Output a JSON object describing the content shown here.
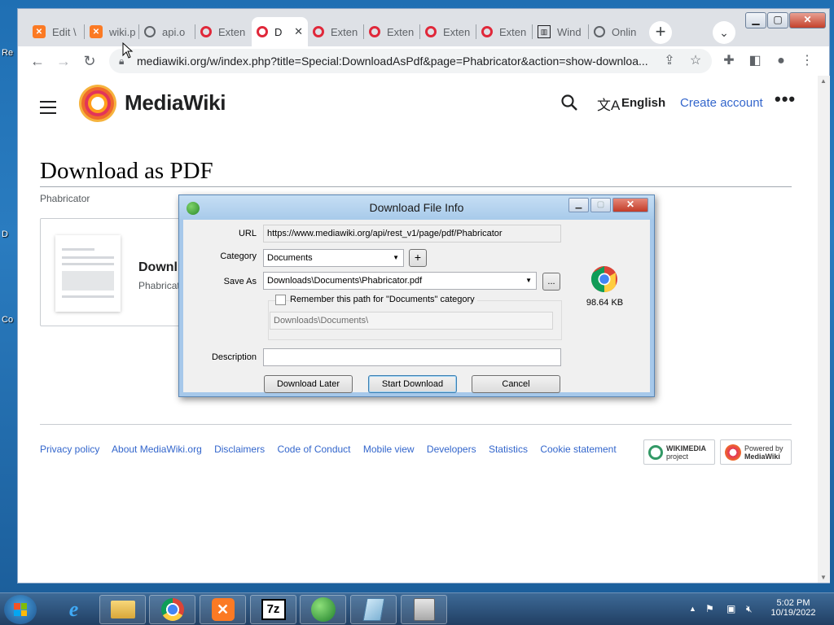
{
  "desktop": {
    "labels": [
      "Re",
      "D",
      "Co"
    ]
  },
  "browser": {
    "tabs": [
      {
        "label": "Edit \\",
        "icon": "xampp-icon"
      },
      {
        "label": "wiki.p",
        "icon": "xampp-icon"
      },
      {
        "label": "api.o",
        "icon": "globe-icon"
      },
      {
        "label": "Exten",
        "icon": "opera-icon"
      },
      {
        "label": "D",
        "icon": "opera-icon",
        "active": true
      },
      {
        "label": "Exten",
        "icon": "opera-icon"
      },
      {
        "label": "Exten",
        "icon": "opera-icon"
      },
      {
        "label": "Exten",
        "icon": "opera-icon"
      },
      {
        "label": "Exten",
        "icon": "opera-icon"
      },
      {
        "label": "Wind",
        "icon": "bank-icon"
      },
      {
        "label": "Onlin",
        "icon": "globe-icon"
      }
    ],
    "active_tab_close": "✕",
    "new_tab": "+",
    "url": "mediawiki.org/w/index.php?title=Special:DownloadAsPdf&page=Phabricator&action=show-downloa..."
  },
  "page": {
    "site_name": "MediaWiki",
    "language": "English",
    "create_account": "Create account",
    "title": "Download as PDF",
    "subtitle": "Phabricator",
    "card_title": "Downl",
    "card_sub": "Phabricat",
    "footer_links": [
      "Privacy policy",
      "About MediaWiki.org",
      "Disclaimers",
      "Code of Conduct",
      "Mobile view",
      "Developers",
      "Statistics",
      "Cookie statement"
    ],
    "badge_wikimedia": [
      "WIKIMEDIA",
      "project"
    ],
    "badge_powered": [
      "Powered by",
      "MediaWiki"
    ]
  },
  "dialog": {
    "title": "Download File Info",
    "url_label": "URL",
    "url_value": "https://www.mediawiki.org/api/rest_v1/page/pdf/Phabricator",
    "category_label": "Category",
    "category_value": "Documents",
    "add_category": "+",
    "save_as_label": "Save As",
    "save_as_value": "Downloads\\Documents\\Phabricator.pdf",
    "browse": "...",
    "remember_label": "Remember this path for \"Documents\" category",
    "remember_checked": false,
    "path_value": "Downloads\\Documents\\",
    "description_label": "Description",
    "description_value": "",
    "file_size": "98.64 KB",
    "btn_later": "Download Later",
    "btn_start": "Start Download",
    "btn_cancel": "Cancel"
  },
  "taskbar": {
    "apps": [
      "ie-icon",
      "explorer-icon",
      "chrome-icon",
      "xampp-icon",
      "7zip-icon",
      "idm-icon",
      "notepad-icon",
      "archive-icon"
    ],
    "time": "5:02 PM",
    "date": "10/19/2022"
  },
  "colors": {
    "link": "#3366cc",
    "dialog_titlebar": "#a8caea",
    "taskbar": "#2c5075"
  }
}
